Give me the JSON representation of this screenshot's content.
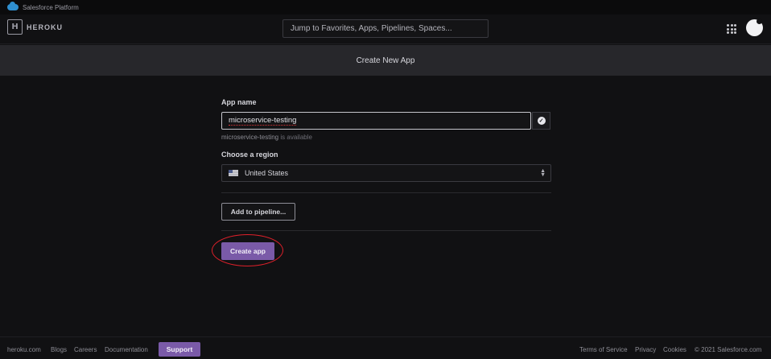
{
  "salesforce_bar": {
    "label": "Salesforce Platform"
  },
  "nav": {
    "logo_mark": "H",
    "logo_text": "HEROKU",
    "search_placeholder": "Jump to Favorites, Apps, Pipelines, Spaces..."
  },
  "page": {
    "title": "Create New App"
  },
  "form": {
    "app_name_label": "App name",
    "app_name_value": "microservice-testing",
    "availability_name": "microservice-testing",
    "availability_suffix": " is available",
    "region_label": "Choose a region",
    "region_value": "United States",
    "add_pipeline_label": "Add to pipeline...",
    "create_app_label": "Create app"
  },
  "footer": {
    "links_left": [
      "heroku.com",
      "Blogs",
      "Careers",
      "Documentation"
    ],
    "support_label": "Support",
    "links_right": [
      "Terms of Service",
      "Privacy",
      "Cookies",
      "© 2021 Salesforce.com"
    ]
  },
  "colors": {
    "accent_purple": "#7a5aa8",
    "background": "#111113",
    "header_band": "#27272b",
    "annotation_red": "#e0202a"
  }
}
